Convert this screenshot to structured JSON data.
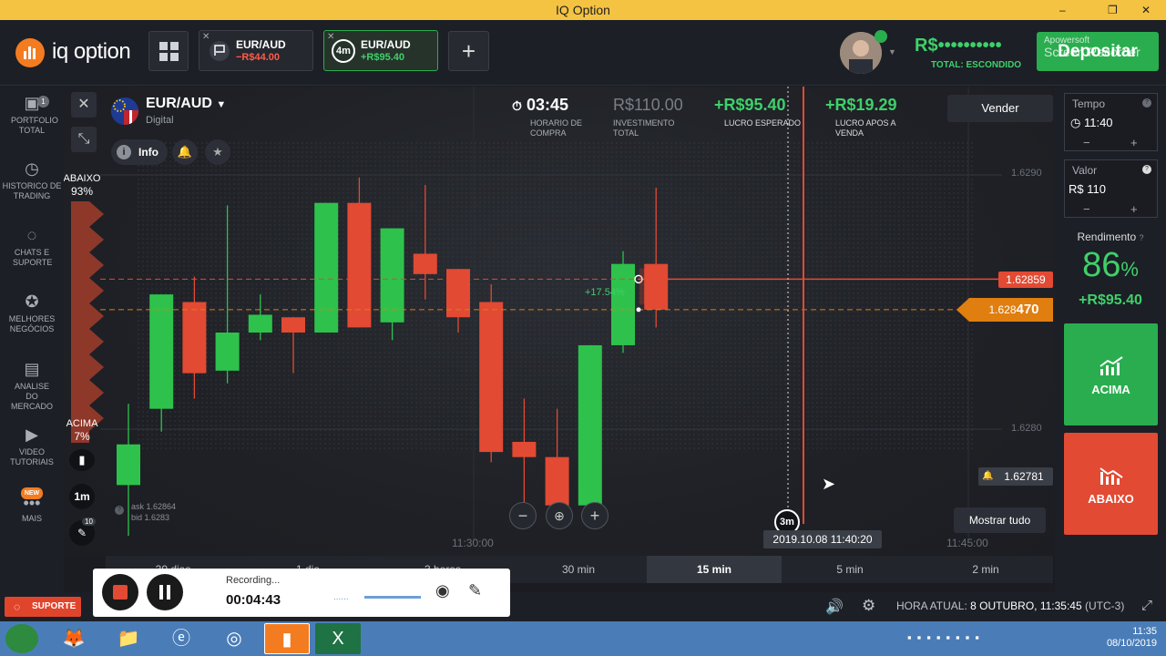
{
  "window": {
    "title": "IQ Option",
    "controls": [
      "–",
      "❐",
      "✕"
    ]
  },
  "header": {
    "logo_text": "iq option",
    "tabs": [
      {
        "pair": "EUR/AUD",
        "pl": "−R$44.00",
        "pl_color": "#ff5a4a",
        "badge": "",
        "active": false
      },
      {
        "pair": "EUR/AUD",
        "pl": "+R$95.40",
        "pl_color": "#3fd06a",
        "badge": "4m",
        "active": true
      }
    ],
    "add_tab": "+",
    "balance": "R$••••••••••",
    "total_label": "TOTAL: ESCONDIDO",
    "deposit_label": "Depositar",
    "watermark_line1": "Apowersoft",
    "watermark_line2": "Screen Recorder"
  },
  "sidebar": {
    "items": [
      {
        "label": "PORTFOLIO TOTAL",
        "icon": "briefcase-icon",
        "badge": "1"
      },
      {
        "label": "HISTORICO DE TRADING",
        "icon": "history-icon"
      },
      {
        "label": "CHATS E SUPORTE",
        "icon": "chat-icon"
      },
      {
        "label": "MELHORES NEGÓCIOS",
        "icon": "trophy-icon"
      },
      {
        "label": "ANALISE DO MERCADO",
        "icon": "news-icon"
      },
      {
        "label": "VIDEO TUTORIAIS",
        "icon": "play-icon"
      },
      {
        "label": "MAIS",
        "icon": "more-icon",
        "badge": "NEW"
      }
    ]
  },
  "asset": {
    "name": "EUR/AUD",
    "type": "Digital",
    "info_label": "Info"
  },
  "stats": {
    "time": "03:45",
    "time_label": "HORARIO DE COMPRA",
    "investment": "R$110.00",
    "investment_label": "INVESTIMENTO TOTAL",
    "expected": "+R$95.40",
    "expected_label": "LUCRO ESPERADO",
    "after_sale": "+R$19.29",
    "after_sale_label": "LUCRO APOS A VENDA"
  },
  "sell_label": "Vender",
  "sentiment": {
    "down_label": "ABAIXO",
    "down_pct": "93%",
    "up_label": "ACIMA",
    "up_pct": "7%"
  },
  "chart_tools": {
    "interval": "1m",
    "drawing_badge": "10"
  },
  "ask_bid": {
    "ask": "ask 1.62864",
    "bid": "bid 1.6283"
  },
  "chart_data": {
    "type": "candlestick",
    "y_ticks": [
      "1.6290",
      "1.6280"
    ],
    "x_ticks": [
      "11:30:00",
      "11:45:00"
    ],
    "price_lines": {
      "high_tag": "1.62859",
      "current_tag_prefix": "1.628",
      "current_tag_suffix": "470",
      "alert_tag": "1.62781"
    },
    "trade_marker_pct": "+17.54%",
    "expiry_badge": "3m",
    "expiry_time": "2019.10.08 11:40:20",
    "candles": [
      {
        "o": 1.62778,
        "c": 1.62794,
        "h": 1.6281,
        "l": 1.62758
      },
      {
        "o": 1.62808,
        "c": 1.62853,
        "h": 1.62853,
        "l": 1.62799
      },
      {
        "o": 1.6285,
        "c": 1.62822,
        "h": 1.6286,
        "l": 1.62812
      },
      {
        "o": 1.62823,
        "c": 1.62838,
        "h": 1.62888,
        "l": 1.62818
      },
      {
        "o": 1.62838,
        "c": 1.62845,
        "h": 1.62853,
        "l": 1.62835
      },
      {
        "o": 1.62844,
        "c": 1.62838,
        "h": 1.62844,
        "l": 1.62822
      },
      {
        "o": 1.62838,
        "c": 1.62889,
        "h": 1.62889,
        "l": 1.62838
      },
      {
        "o": 1.62889,
        "c": 1.6284,
        "h": 1.62899,
        "l": 1.6284
      },
      {
        "o": 1.62842,
        "c": 1.62879,
        "h": 1.62879,
        "l": 1.62835
      },
      {
        "o": 1.62869,
        "c": 1.62861,
        "h": 1.62896,
        "l": 1.62851
      },
      {
        "o": 1.62863,
        "c": 1.62844,
        "h": 1.62863,
        "l": 1.62838
      },
      {
        "o": 1.6285,
        "c": 1.62791,
        "h": 1.62857,
        "l": 1.62787
      },
      {
        "o": 1.62795,
        "c": 1.62789,
        "h": 1.62812,
        "l": 1.6277
      },
      {
        "o": 1.62789,
        "c": 1.6277,
        "h": 1.62808,
        "l": 1.62765
      },
      {
        "o": 1.6277,
        "c": 1.62833,
        "h": 1.62833,
        "l": 1.6277
      },
      {
        "o": 1.62833,
        "c": 1.62865,
        "h": 1.6287,
        "l": 1.6283
      },
      {
        "o": 1.62865,
        "c": 1.62847,
        "h": 1.62895,
        "l": 1.6284
      }
    ]
  },
  "zoom": {
    "minus": "−",
    "plus": "+"
  },
  "show_all_label": "Mostrar tudo",
  "timeframes": [
    {
      "label": "30 dias",
      "active": false
    },
    {
      "label": "1 dia",
      "active": false
    },
    {
      "label": "3 horas",
      "active": false
    },
    {
      "label": "30 min",
      "active": false
    },
    {
      "label": "15 min",
      "active": true
    },
    {
      "label": "5 min",
      "active": false
    },
    {
      "label": "2 min",
      "active": false
    }
  ],
  "right": {
    "time_label": "Tempo",
    "time_value": "11:40",
    "amount_label": "Valor",
    "amount_value": "R$ 110",
    "yield_label": "Rendimento",
    "yield_value": "86",
    "yield_unit": "%",
    "yield_profit": "+R$95.40",
    "up_label": "ACIMA",
    "down_label": "ABAIXO",
    "up_color": "#2aad4e",
    "down_color": "#e24a33"
  },
  "bottom": {
    "support_label": "SUPORTE",
    "hora_label": "HORA ATUAL:",
    "hora_value": "8 OUTUBRO, 11:35:45",
    "tz": "(UTC-3)"
  },
  "recorder": {
    "status": "Recording...",
    "elapsed": "00:04:43",
    "dots": "......"
  },
  "taskbar": {
    "time": "11:35",
    "date": "08/10/2019"
  }
}
